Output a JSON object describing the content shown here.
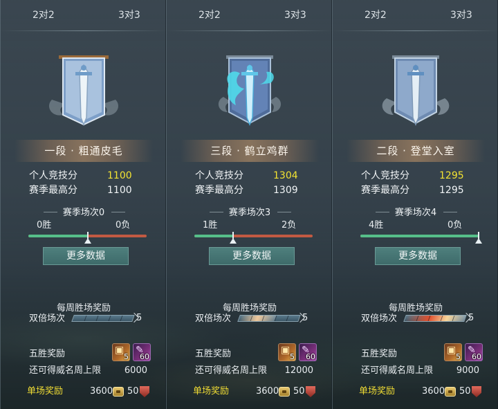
{
  "tabs": [
    {
      "label": "2对2"
    },
    {
      "label": "3对3"
    }
  ],
  "labels": {
    "personal_score": "个人竞技分",
    "season_best": "赛季最高分",
    "more_data": "更多数据",
    "weekly_reward": "每周胜场奖励",
    "double_matches": "双倍场次",
    "five_win_reward": "五胜奖励",
    "remaining_fame_cap": "还可得威名周上限",
    "per_match_reward": "单场奖励"
  },
  "icons": {
    "chest": "treasure-chest-icon",
    "scroll": "purple-scroll-icon",
    "coin": "coin-icon",
    "badge": "fame-badge-icon",
    "emblem": "sword-banner-icon"
  },
  "colors": {
    "highlight_score": "#f3e332",
    "win_bar": "#56bf8a",
    "loss_bar": "#c25a42",
    "single_reward_label": "#f0dc34"
  },
  "panels": [
    {
      "rank": "三段 · 鹤立鸡群",
      "score": "1304",
      "best": "1309",
      "season": "赛季场次3",
      "wins": "1胜",
      "losses": "2负",
      "win_ratio": 0.33,
      "weekly_progress": 0.6,
      "weekly_max": "5",
      "chest_count": "5",
      "scroll_count": "60",
      "fame_cap": "12000",
      "coin_reward": "3600",
      "badge_reward": "50"
    },
    {
      "rank": "二段 · 登堂入室",
      "score": "1295",
      "best": "1295",
      "season": "赛季场次4",
      "wins": "4胜",
      "losses": "0负",
      "win_ratio": 1.0,
      "weekly_progress": 1.0,
      "weekly_max": "5",
      "chest_count": "5",
      "scroll_count": "60",
      "fame_cap": "9000",
      "coin_reward": "3600",
      "badge_reward": "50"
    },
    {
      "rank": "一段 · 粗通皮毛",
      "score": "1100",
      "best": "1100",
      "season": "赛季场次0",
      "wins": "0胜",
      "losses": "0负",
      "win_ratio": 0.5,
      "weekly_progress": 0.0,
      "weekly_max": "5",
      "chest_count": "5",
      "scroll_count": "60",
      "fame_cap": "6000",
      "coin_reward": "3600",
      "badge_reward": "50"
    }
  ]
}
